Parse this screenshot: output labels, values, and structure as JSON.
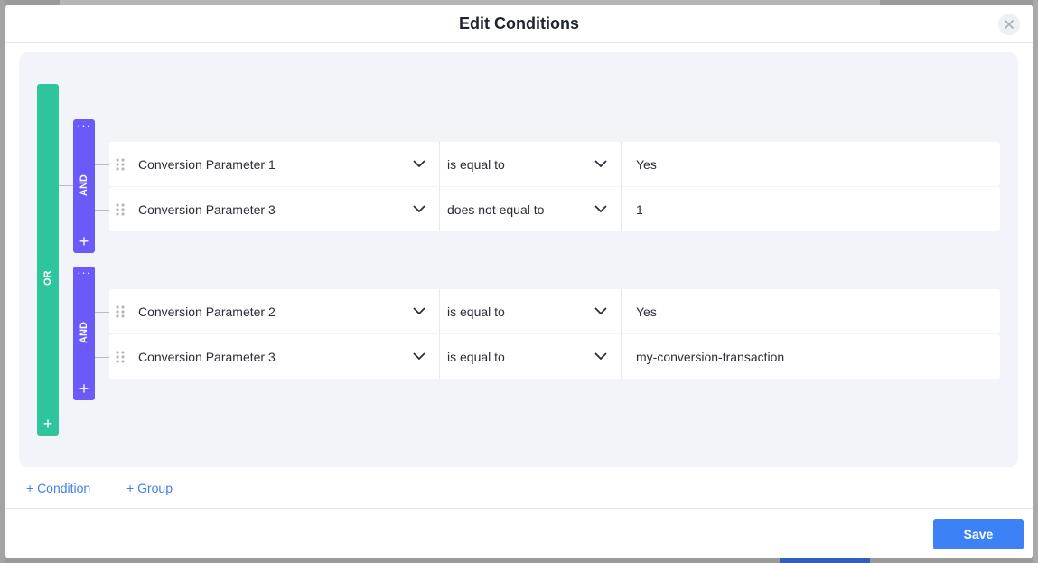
{
  "modal": {
    "title": "Edit Conditions"
  },
  "or_group": {
    "label": "OR",
    "add": "+"
  },
  "and_groups": [
    {
      "label": "AND",
      "menu": "···",
      "add": "+",
      "conditions": [
        {
          "field": "Conversion Parameter 1",
          "operator": "is equal to",
          "value": "Yes"
        },
        {
          "field": "Conversion Parameter 3",
          "operator": "does not equal to",
          "value": "1"
        }
      ]
    },
    {
      "label": "AND",
      "menu": "···",
      "add": "+",
      "conditions": [
        {
          "field": "Conversion Parameter 2",
          "operator": "is equal to",
          "value": "Yes"
        },
        {
          "field": "Conversion Parameter 3",
          "operator": "is equal to",
          "value": "my-conversion-transaction"
        }
      ]
    }
  ],
  "actions": {
    "add_condition": "+ Condition",
    "add_group": "+ Group",
    "save": "Save"
  },
  "colors": {
    "or_bar": "#2ec59c",
    "and_bar": "#6a5af9",
    "link": "#3f7ff0",
    "primary_button": "#3c82f6"
  }
}
